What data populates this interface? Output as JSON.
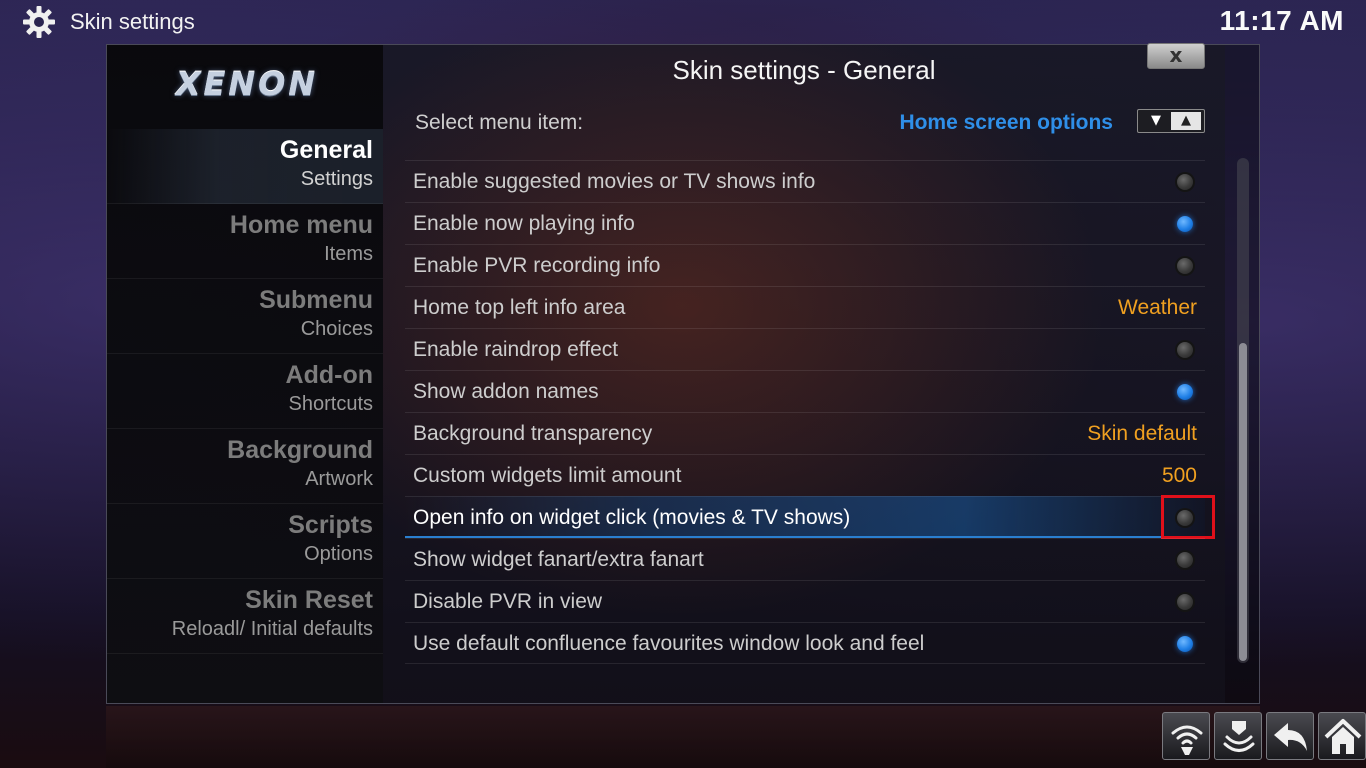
{
  "topbar": {
    "icon": "gear-icon",
    "title": "Skin settings",
    "clock": "11:17 AM"
  },
  "logo": "XENON",
  "sidebar": {
    "items": [
      {
        "title": "General",
        "subtitle": "Settings",
        "active": true
      },
      {
        "title": "Home menu",
        "subtitle": "Items",
        "active": false
      },
      {
        "title": "Submenu",
        "subtitle": "Choices",
        "active": false
      },
      {
        "title": "Add-on",
        "subtitle": "Shortcuts",
        "active": false
      },
      {
        "title": "Background",
        "subtitle": "Artwork",
        "active": false
      },
      {
        "title": "Scripts",
        "subtitle": "Options",
        "active": false
      },
      {
        "title": "Skin Reset",
        "subtitle": "Reloadl/ Initial defaults",
        "active": false
      }
    ]
  },
  "content": {
    "title": "Skin settings - General",
    "close_label": "x",
    "select": {
      "label": "Select menu item:",
      "value": "Home screen options",
      "down_glyph": "▼",
      "up_glyph": "▲"
    },
    "settings": [
      {
        "label": "Enable suggested movies or TV shows info",
        "type": "radio",
        "on": false
      },
      {
        "label": "Enable now playing info",
        "type": "radio",
        "on": true
      },
      {
        "label": "Enable PVR recording info",
        "type": "radio",
        "on": false
      },
      {
        "label": "Home top left info area",
        "type": "value",
        "value": "Weather"
      },
      {
        "label": "Enable raindrop effect",
        "type": "radio",
        "on": false
      },
      {
        "label": "Show addon names",
        "type": "radio",
        "on": true
      },
      {
        "label": "Background transparency",
        "type": "value",
        "value": "Skin default"
      },
      {
        "label": "Custom widgets limit amount",
        "type": "value",
        "value": "500"
      },
      {
        "label": "Open info on widget click (movies & TV shows)",
        "type": "radio",
        "on": false,
        "focused": true
      },
      {
        "label": "Show widget fanart/extra fanart",
        "type": "radio",
        "on": false
      },
      {
        "label": "Disable PVR in view",
        "type": "radio",
        "on": false
      },
      {
        "label": "Use default confluence favourites window look and feel",
        "type": "radio",
        "on": true
      }
    ],
    "scroll_position": 0.37
  },
  "bottom_buttons": [
    "wifi-icon",
    "eject-icon",
    "back-icon",
    "home-icon"
  ],
  "colors": {
    "accent_blue": "#2f8fe8",
    "value_orange": "#f0a020",
    "highlight_red": "#e0101a"
  }
}
